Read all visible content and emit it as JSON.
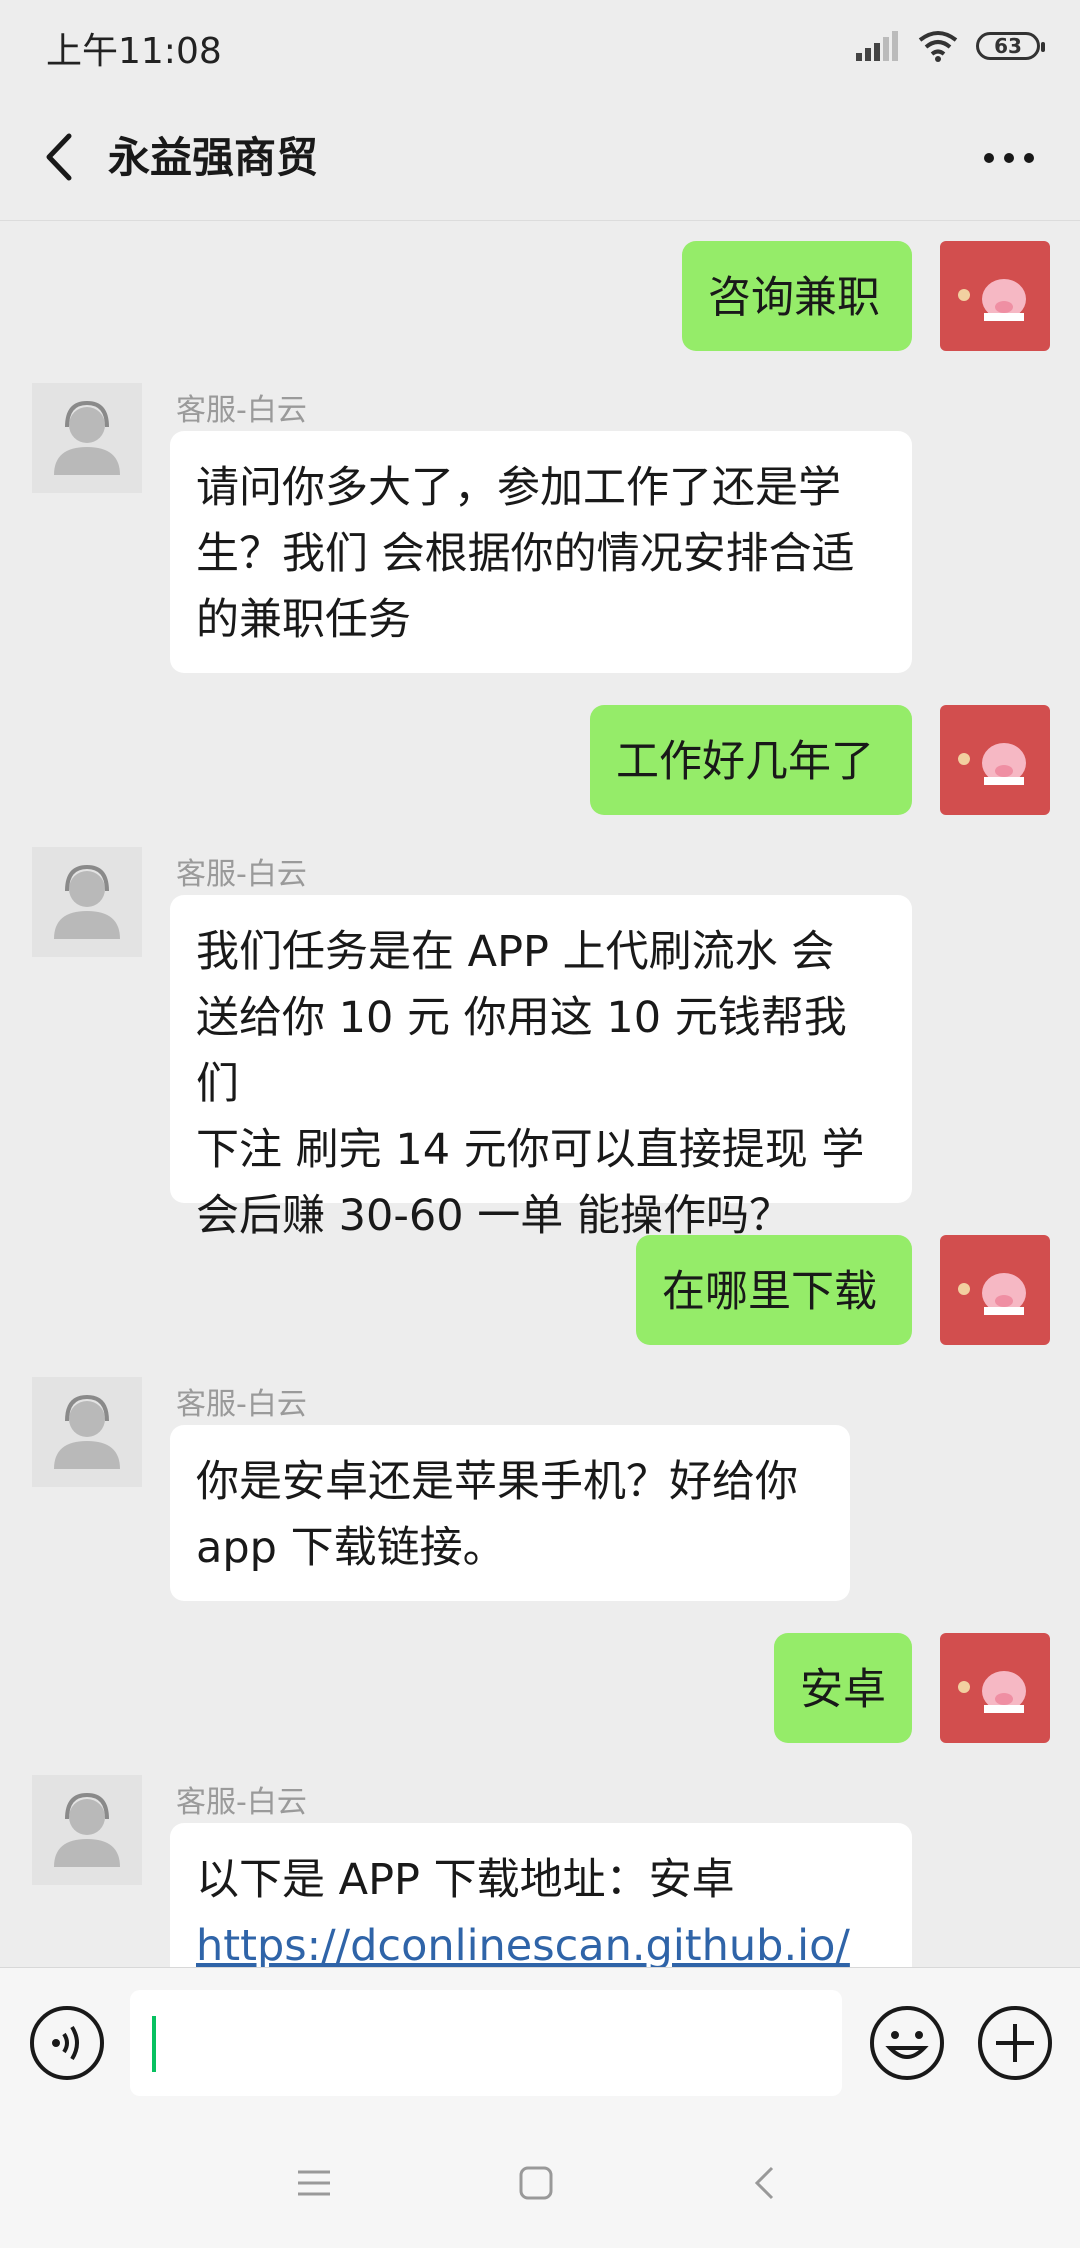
{
  "status_bar": {
    "time": "上午11:08",
    "battery": "63"
  },
  "header": {
    "title": "永益强商贸"
  },
  "messages": [
    {
      "from": "me",
      "text": "咨询兼职"
    },
    {
      "from": "cs",
      "sender": "客服-白云",
      "lines": [
        "请问你多大了，参加工作了还是学",
        "生？我们 会根据你的情况安排合适",
        "的兼职任务"
      ]
    },
    {
      "from": "me",
      "text": "工作好几年了"
    },
    {
      "from": "cs",
      "sender": "客服-白云",
      "lines": [
        "我们任务是在 APP 上代刷流水 会",
        "送给你 10 元 你用这 10 元钱帮我们",
        "下注 刷完 14 元你可以直接提现 学",
        "会后赚 30-60 一单 能操作吗？"
      ]
    },
    {
      "from": "me",
      "text": "在哪里下载"
    },
    {
      "from": "cs",
      "sender": "客服-白云",
      "lines": [
        "你是安卓还是苹果手机？好给你",
        "app 下载链接。"
      ]
    },
    {
      "from": "me",
      "text": "安卓"
    },
    {
      "from": "cs",
      "sender": "客服-白云",
      "lines": [
        "以下是 APP 下载地址：安卓"
      ],
      "link": "https://dconlinescan.github.io/"
    }
  ],
  "input": {
    "value": ""
  },
  "icons": {
    "back": "chevron-left-icon",
    "more": "more-dots-icon",
    "voice": "voice-icon",
    "emoji": "emoji-icon",
    "plus": "plus-icon"
  },
  "colors": {
    "my_bubble": "#95ec69",
    "their_bubble": "#ffffff",
    "background": "#ededed",
    "link": "#2f64a8"
  }
}
